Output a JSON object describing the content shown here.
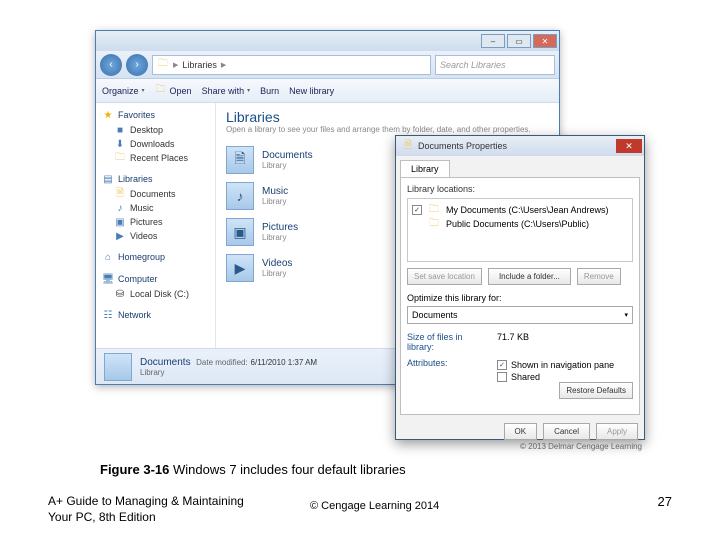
{
  "explorer": {
    "nav_back": "‹",
    "nav_fwd": "›",
    "breadcrumb": [
      "Libraries"
    ],
    "search_placeholder": "Search Libraries",
    "toolbar": {
      "organize": "Organize",
      "open": "Open",
      "share": "Share with",
      "burn": "Burn",
      "newlib": "New library"
    },
    "sidebar": {
      "favorites": {
        "hdr": "Favorites",
        "items": [
          "Desktop",
          "Downloads",
          "Recent Places"
        ]
      },
      "libraries": {
        "hdr": "Libraries",
        "items": [
          "Documents",
          "Music",
          "Pictures",
          "Videos"
        ]
      },
      "homegroup": {
        "hdr": "Homegroup"
      },
      "computer": {
        "hdr": "Computer",
        "items": [
          "Local Disk (C:)"
        ]
      },
      "network": {
        "hdr": "Network"
      }
    },
    "content": {
      "title": "Libraries",
      "subtitle": "Open a library to see your files and arrange them by folder, date, and other properties.",
      "items": [
        {
          "name": "Documents",
          "sub": "Library"
        },
        {
          "name": "Music",
          "sub": "Library"
        },
        {
          "name": "Pictures",
          "sub": "Library"
        },
        {
          "name": "Videos",
          "sub": "Library"
        }
      ]
    },
    "details": {
      "name": "Documents",
      "modified_label": "Date modified:",
      "modified": "6/11/2010 1:37 AM",
      "sub": "Library"
    }
  },
  "props": {
    "title": "Documents Properties",
    "tab": "Library",
    "loc_label": "Library locations:",
    "locations": [
      {
        "checked": true,
        "path": "My Documents (C:\\Users\\Jean Andrews)"
      },
      {
        "checked": false,
        "path": "Public Documents (C:\\Users\\Public)"
      }
    ],
    "btn_setsave": "Set save location",
    "btn_include": "Include a folder...",
    "btn_remove": "Remove",
    "opt_label": "Optimize this library for:",
    "opt_value": "Documents",
    "size_label": "Size of files in library:",
    "size_value": "71.7 KB",
    "attr_label": "Attributes:",
    "attr_shownav": "Shown in navigation pane",
    "attr_shared": "Shared",
    "restore": "Restore Defaults",
    "ok": "OK",
    "cancel": "Cancel",
    "apply": "Apply"
  },
  "img_copyright": "© 2013 Delmar Cengage Learning",
  "caption_bold": "Figure 3-16",
  "caption_rest": " Windows 7 includes four default libraries",
  "footer_left_1": "A+ Guide to Managing & Maintaining",
  "footer_left_2": "Your PC, 8th Edition",
  "footer_mid": "© Cengage Learning  2014",
  "footer_right": "27"
}
